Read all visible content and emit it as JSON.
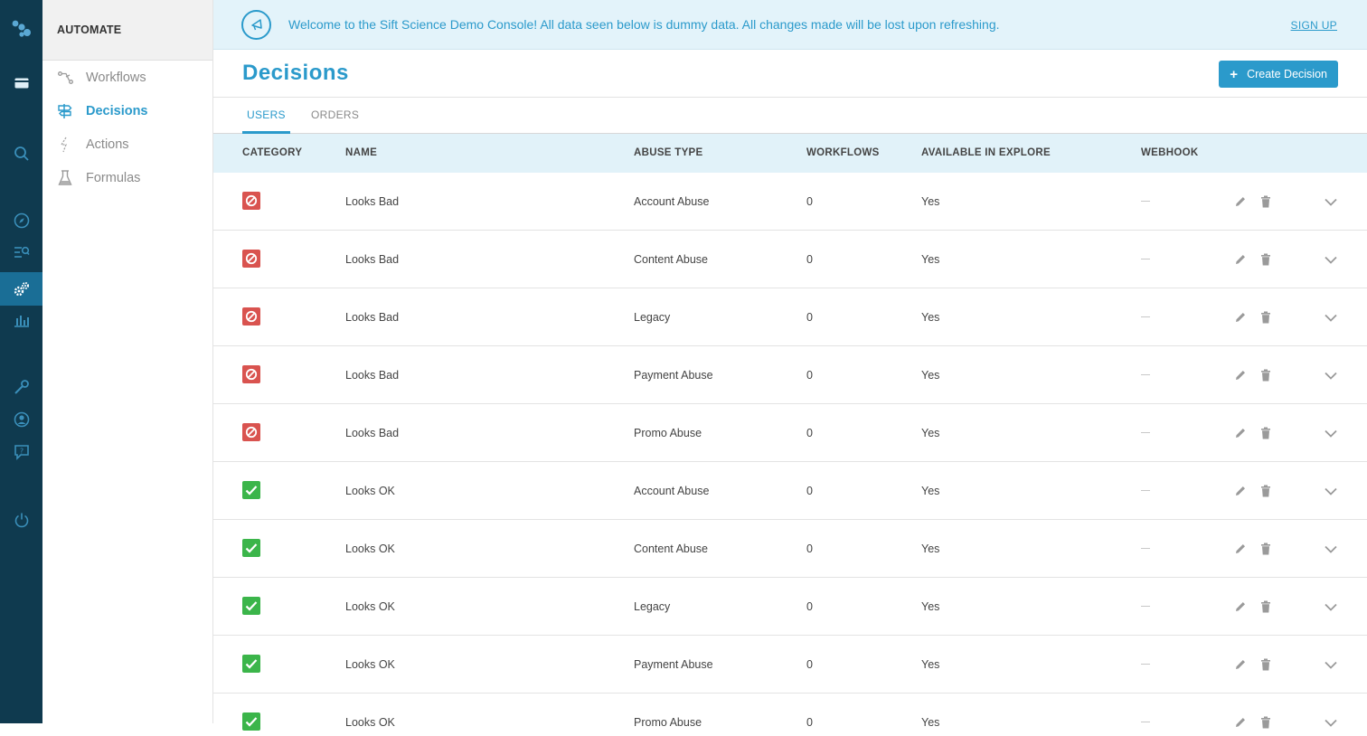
{
  "banner": {
    "message": "Welcome to the Sift Science Demo Console! All data seen below is dummy data. All changes made will be lost upon refreshing.",
    "signup_label": "SIGN UP"
  },
  "subnav": {
    "heading": "AUTOMATE",
    "items": [
      {
        "label": "Workflows",
        "icon": "workflows-icon"
      },
      {
        "label": "Decisions",
        "icon": "decisions-icon"
      },
      {
        "label": "Actions",
        "icon": "actions-icon"
      },
      {
        "label": "Formulas",
        "icon": "formulas-icon"
      }
    ],
    "active_index": 1
  },
  "page": {
    "title": "Decisions",
    "create_button_label": "Create Decision"
  },
  "tabs": [
    {
      "label": "USERS",
      "active": true
    },
    {
      "label": "ORDERS",
      "active": false
    }
  ],
  "table": {
    "headers": {
      "category": "CATEGORY",
      "name": "NAME",
      "abuse_type": "ABUSE TYPE",
      "workflows": "WORKFLOWS",
      "available": "AVAILABLE IN EXPLORE",
      "webhook": "WEBHOOK"
    },
    "rows": [
      {
        "category": "bad",
        "name": "Looks Bad",
        "abuse_type": "Account Abuse",
        "workflows": "0",
        "available": "Yes"
      },
      {
        "category": "bad",
        "name": "Looks Bad",
        "abuse_type": "Content Abuse",
        "workflows": "0",
        "available": "Yes"
      },
      {
        "category": "bad",
        "name": "Looks Bad",
        "abuse_type": "Legacy",
        "workflows": "0",
        "available": "Yes"
      },
      {
        "category": "bad",
        "name": "Looks Bad",
        "abuse_type": "Payment Abuse",
        "workflows": "0",
        "available": "Yes"
      },
      {
        "category": "bad",
        "name": "Looks Bad",
        "abuse_type": "Promo Abuse",
        "workflows": "0",
        "available": "Yes"
      },
      {
        "category": "ok",
        "name": "Looks OK",
        "abuse_type": "Account Abuse",
        "workflows": "0",
        "available": "Yes"
      },
      {
        "category": "ok",
        "name": "Looks OK",
        "abuse_type": "Content Abuse",
        "workflows": "0",
        "available": "Yes"
      },
      {
        "category": "ok",
        "name": "Looks OK",
        "abuse_type": "Legacy",
        "workflows": "0",
        "available": "Yes"
      },
      {
        "category": "ok",
        "name": "Looks OK",
        "abuse_type": "Payment Abuse",
        "workflows": "0",
        "available": "Yes"
      },
      {
        "category": "ok",
        "name": "Looks OK",
        "abuse_type": "Promo Abuse",
        "workflows": "0",
        "available": "Yes"
      }
    ]
  },
  "colors": {
    "accent": "#2b9acb",
    "rail": "#0f3a4f",
    "rail_active": "#1a6e96",
    "bad": "#d9534f",
    "ok": "#3bb54a",
    "banner_bg": "#e3f3fa",
    "header_bg": "#e1f2f9"
  },
  "rail_icons": [
    "logo-icon",
    "card-icon",
    "search-icon",
    "compass-icon",
    "list-search-icon",
    "settings-gears-icon",
    "bar-chart-icon",
    "wrench-icon",
    "user-circle-icon",
    "help-chat-icon",
    "power-icon"
  ],
  "rail_active_icon": "settings-gears-icon"
}
